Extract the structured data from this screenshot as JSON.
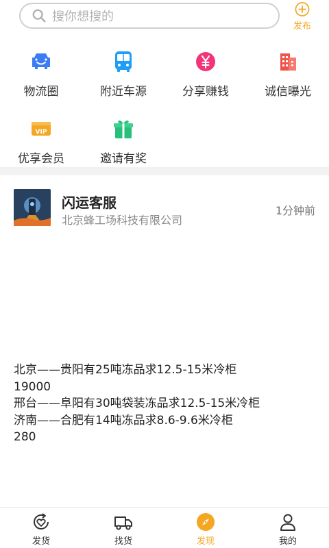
{
  "search": {
    "placeholder": "搜你想搜的"
  },
  "header": {
    "publish_label": "发布"
  },
  "grid": {
    "items": [
      {
        "label": "物流圈",
        "icon": "car-icon",
        "color": "#3b7cf5"
      },
      {
        "label": "附近车源",
        "icon": "bus-icon",
        "color": "#1e9ef5"
      },
      {
        "label": "分享赚钱",
        "icon": "yuan-coin-icon",
        "color": "#f0357a"
      },
      {
        "label": "诚信曝光",
        "icon": "building-icon",
        "color": "#f0524a"
      },
      {
        "label": "优享会员",
        "icon": "vip-card-icon",
        "color": "#f5a623"
      },
      {
        "label": "邀请有奖",
        "icon": "gift-icon",
        "color": "#27c07a"
      }
    ]
  },
  "post": {
    "author": "闪运客服",
    "company": "北京蜂工场科技有限公司",
    "time": "1分钟前",
    "lines": [
      "北京——贵阳有25吨冻品求12.5-15米冷柜",
      "19000",
      "邢台——阜阳有30吨袋装冻品求12.5-15米冷柜",
      "济南——合肥有14吨冻品求8.6-9.6米冷柜",
      "280"
    ]
  },
  "tabbar": {
    "tabs": [
      {
        "label": "发货",
        "icon": "heart-cycle-icon",
        "active": false
      },
      {
        "label": "找货",
        "icon": "truck-icon",
        "active": false
      },
      {
        "label": "发现",
        "icon": "compass-icon",
        "active": true
      },
      {
        "label": "我的",
        "icon": "user-icon",
        "active": false
      }
    ]
  },
  "colors": {
    "accent": "#f5a623",
    "text": "#222222",
    "muted": "#888888"
  }
}
